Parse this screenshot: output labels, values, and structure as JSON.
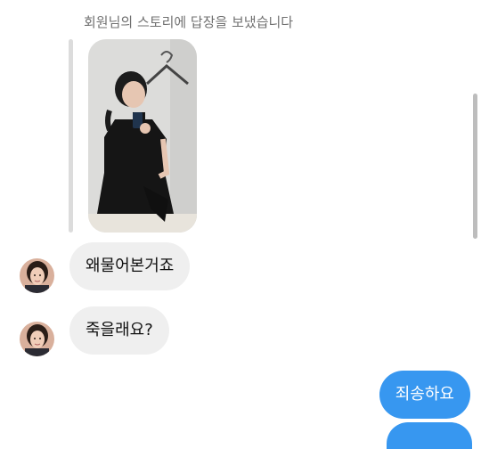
{
  "story_reply": {
    "caption": "회원님의 스토리에 답장을 보냈습니다",
    "thumbnail": "story-photo"
  },
  "messages_incoming": [
    {
      "text": "왜물어본거죠"
    },
    {
      "text": "죽을래요?"
    }
  ],
  "messages_outgoing": [
    {
      "text": "죄송하요"
    }
  ],
  "colors": {
    "outgoing_bubble": "#3797f0",
    "incoming_bubble": "#efefef",
    "caption_text": "#707070"
  }
}
